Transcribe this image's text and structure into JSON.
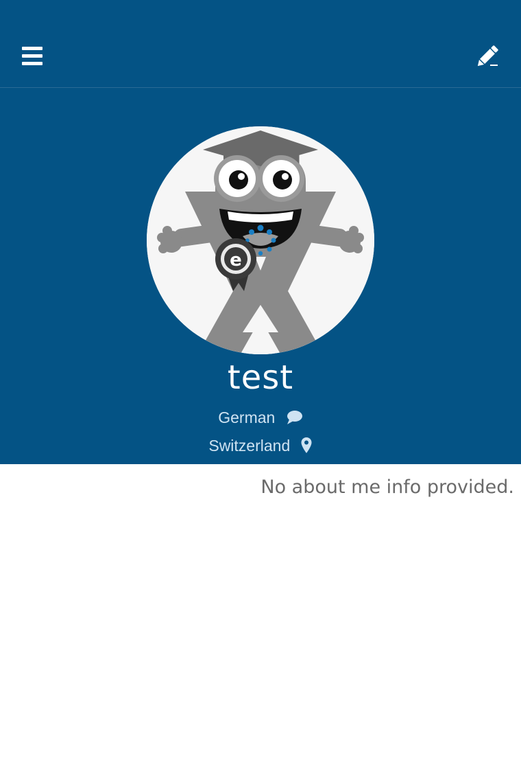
{
  "header": {
    "menu_icon": "hamburger-menu-icon",
    "edit_icon": "pencil-icon",
    "background_color": "#045385"
  },
  "profile": {
    "avatar_icon": "mascot-avatar-icon",
    "username": "test",
    "language": "German",
    "language_icon": "speech-bubble-icon",
    "location": "Switzerland",
    "location_icon": "map-pin-icon",
    "about_me": "No about me info provided."
  },
  "colors": {
    "brand_blue": "#045385",
    "meta_text": "#cfe3f2",
    "body_text": "#6a6a6a",
    "accent_blue": "#1a7fc4"
  }
}
